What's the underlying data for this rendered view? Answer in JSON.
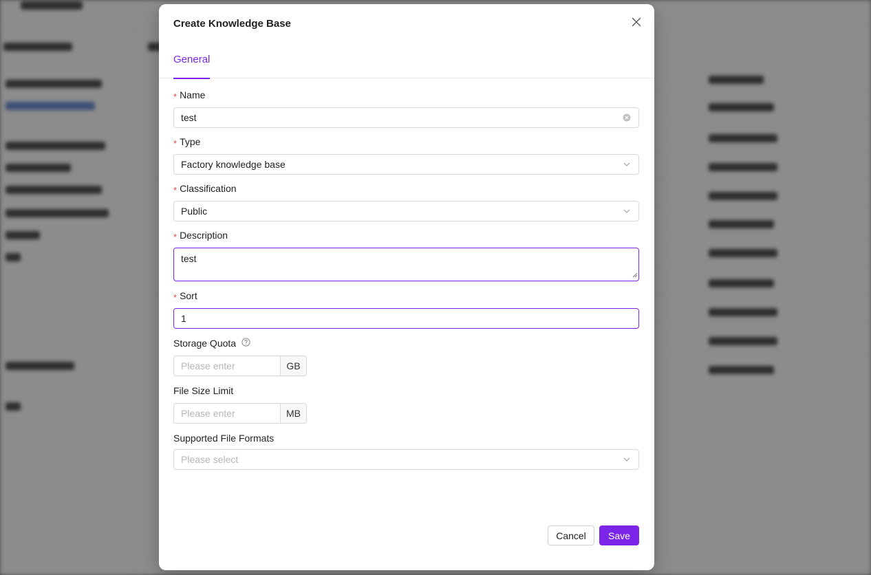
{
  "dialog": {
    "title": "Create Knowledge Base",
    "tabs": [
      {
        "label": "General",
        "active": true
      }
    ],
    "fields": {
      "name": {
        "label": "Name",
        "required": true,
        "value": "test"
      },
      "type": {
        "label": "Type",
        "required": true,
        "value": "Factory knowledge base"
      },
      "classification": {
        "label": "Classification",
        "required": true,
        "value": "Public"
      },
      "description": {
        "label": "Description",
        "required": true,
        "value": "test"
      },
      "sort": {
        "label": "Sort",
        "required": true,
        "value": "1"
      },
      "storage_quota": {
        "label": "Storage Quota",
        "placeholder": "Please enter",
        "unit": "GB"
      },
      "file_size_limit": {
        "label": "File Size Limit",
        "placeholder": "Please enter",
        "unit": "MB"
      },
      "supported_formats": {
        "label": "Supported File Formats",
        "placeholder": "Please select"
      }
    },
    "buttons": {
      "cancel": "Cancel",
      "save": "Save"
    }
  },
  "colors": {
    "accent": "#7b25e8",
    "required": "#e5484d",
    "border": "#d9d9d9",
    "placeholder": "#b5b5b5",
    "overlay": "rgba(0,0,0,0.45)"
  },
  "icons": {
    "close": "close-icon",
    "clear": "clear-circle-icon",
    "dropdown": "chevron-down-icon",
    "help": "question-circle-icon",
    "resize": "resize-grip-icon"
  }
}
